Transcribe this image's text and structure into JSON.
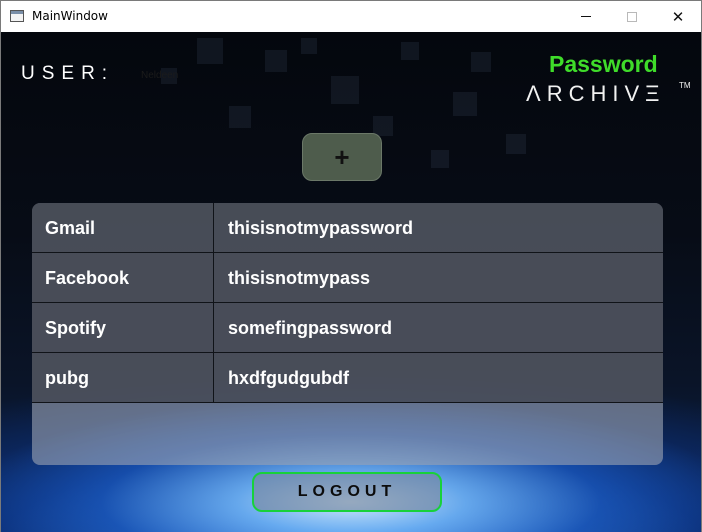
{
  "window": {
    "title": "MainWindow",
    "controls": {
      "minimize": "",
      "maximize": "",
      "close": "✕"
    }
  },
  "header": {
    "user_label": "USER:",
    "user_value": "Neldeen",
    "logo_password": "Password",
    "logo_archive": "ΛRCHIVΞ",
    "logo_tm": "TM"
  },
  "toolbar": {
    "add_label": "+"
  },
  "entries": [
    {
      "name": "Gmail",
      "password": "thisisnotmypassword"
    },
    {
      "name": "Facebook",
      "password": "thisisnotmypass"
    },
    {
      "name": "Spotify",
      "password": "somefingpassword"
    },
    {
      "name": "pubg",
      "password": "hxdfgudgubdf"
    }
  ],
  "footer": {
    "logout_label": "LOGOUT"
  },
  "colors": {
    "accent_green": "#3fdc2a",
    "logout_border": "#18d13a",
    "add_button": "#4e5c4c"
  }
}
